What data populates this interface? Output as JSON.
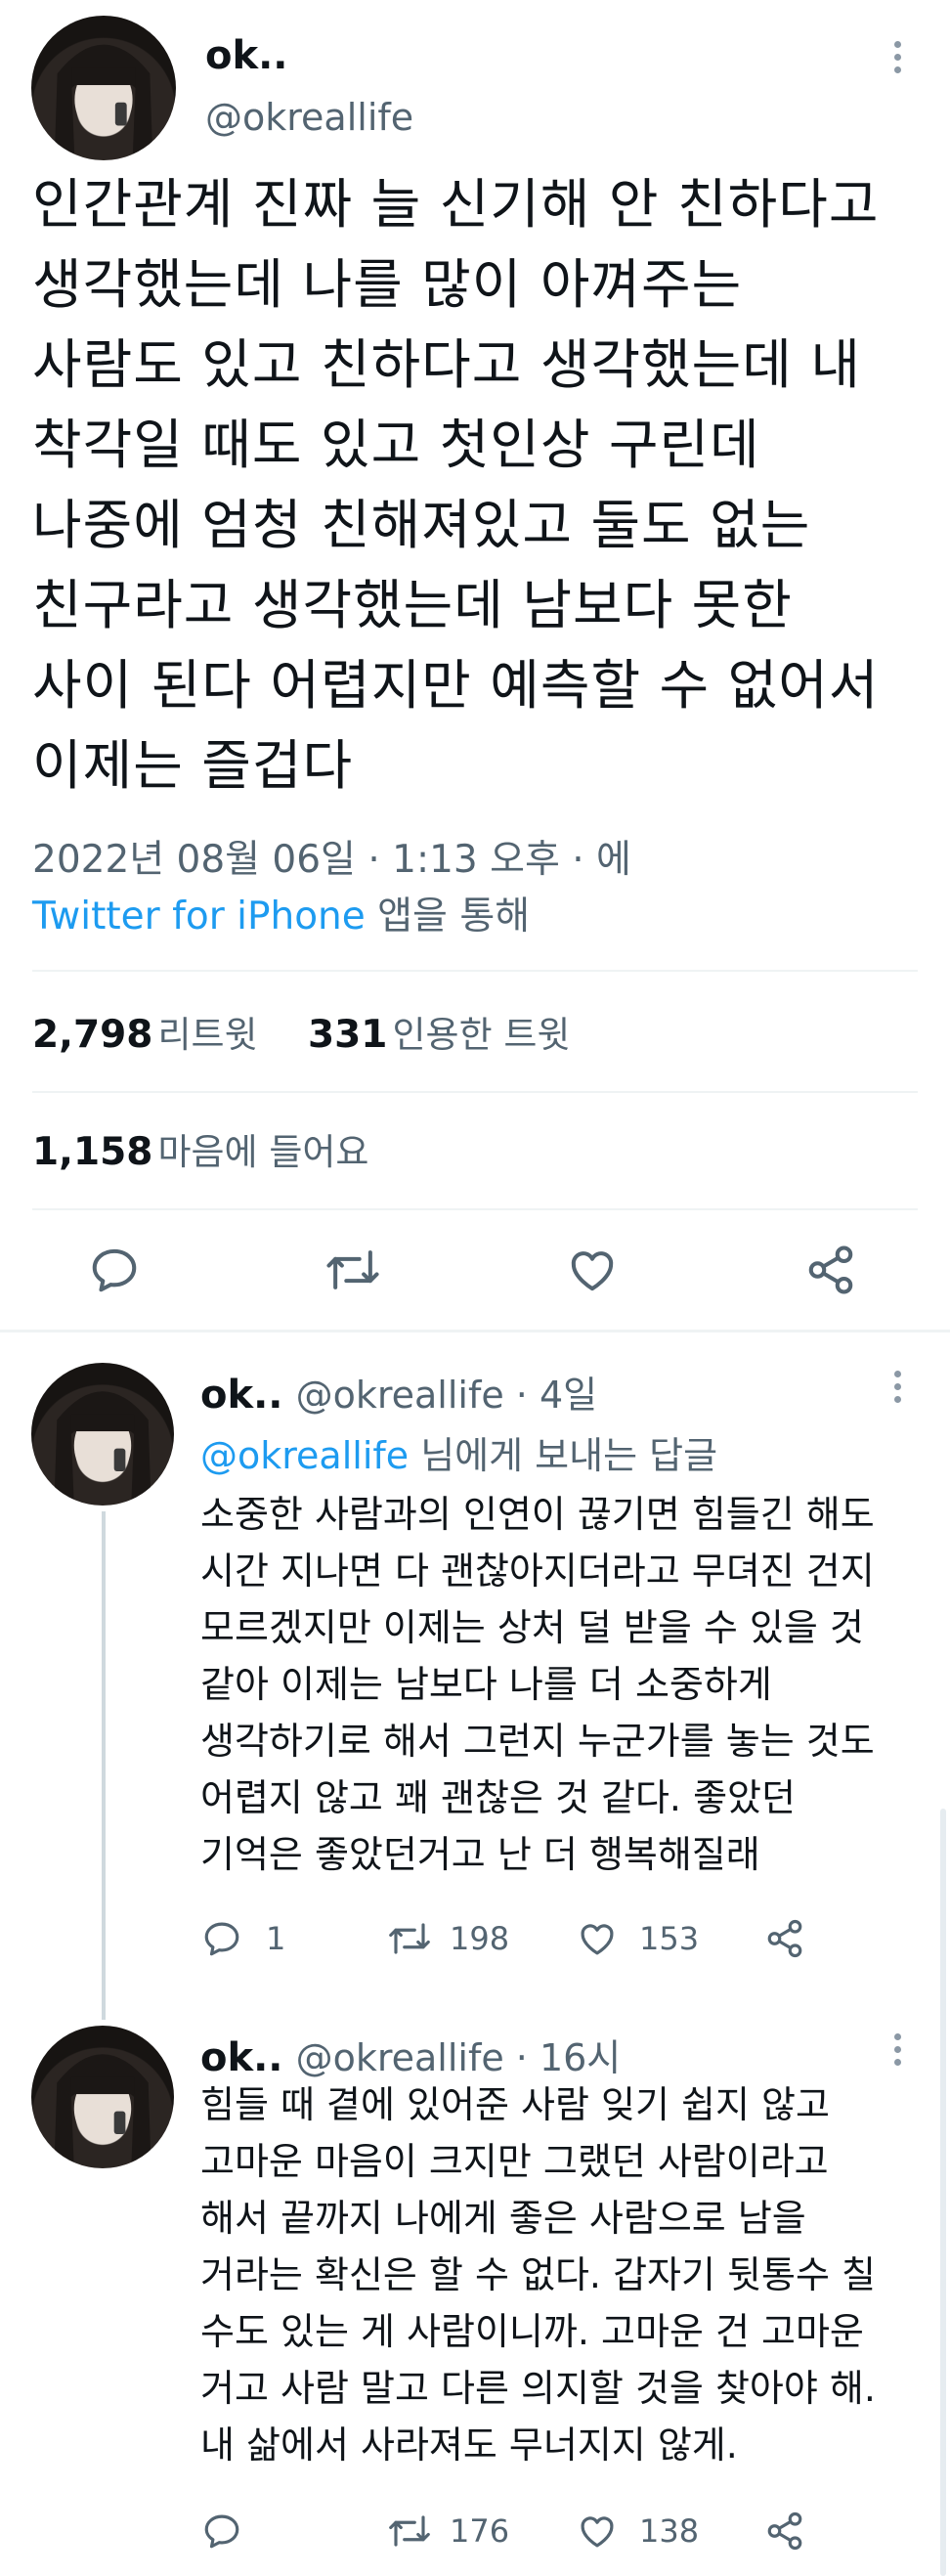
{
  "main_tweet": {
    "name": "ok..",
    "handle": "@okreallife",
    "text_lines": [
      "인간관계 진짜 늘 신기해 안 친하다고",
      "생각했는데 나를 많이 아껴주는",
      "사람도 있고 친하다고 생각했는데 내",
      "착각일 때도 있고 첫인상 구린데",
      "나중에 엄청 친해져있고 둘도 없는",
      "친구라고 생각했는데 남보다 못한",
      "사이 된다 어렵지만 예측할 수 없어서",
      "이제는 즐겁다"
    ],
    "timestamp": "2022년 08월 06일 · 1:13 오후 · 에",
    "source": "Twitter for iPhone",
    "source_suffix": " 앱을 통해",
    "retweets": "2,798",
    "retweets_label": "리트윗",
    "quotes": "331",
    "quotes_label": "인용한 트윗",
    "likes": "1,158",
    "likes_label": "마음에 들어요"
  },
  "replies": [
    {
      "name": "ok..",
      "handle_time": "@okreallife · 4일",
      "replying_to": "@okreallife",
      "replying_suffix": " 님에게 보내는 답글",
      "text_lines": [
        "소중한 사람과의 인연이 끊기면 힘들긴 해도",
        "시간 지나면 다 괜찮아지더라고 무뎌진 건지",
        "모르겠지만 이제는 상처 덜 받을 수 있을 것",
        "같아 이제는 남보다 나를 더 소중하게",
        "생각하기로 해서 그런지 누군가를 놓는 것도",
        "어렵지 않고 꽤 괜찮은 것 같다. 좋았던",
        "기억은 좋았던거고 난 더 행복해질래"
      ],
      "reply_count": "1",
      "retweet_count": "198",
      "like_count": "153"
    },
    {
      "name": "ok..",
      "handle_time": "@okreallife · 16시",
      "text_lines": [
        "힘들 때 곁에 있어준 사람 잊기 쉽지 않고",
        "고마운 마음이 크지만 그랬던 사람이라고",
        "해서 끝까지 나에게 좋은 사람으로 남을",
        "거라는 확신은 할 수 없다. 갑자기 뒷통수 칠",
        "수도 있는 게 사람이니까. 고마운 건 고마운",
        "거고 사람 말고 다른 의지할 것을 찾아야 해.",
        "내 삶에서 사라져도 무너지지 않게."
      ],
      "reply_count": "",
      "retweet_count": "176",
      "like_count": "138"
    }
  ],
  "colors": {
    "accent": "#1d9bf0",
    "muted": "#536471",
    "text": "#0f1419",
    "divider": "#eff3f4"
  },
  "icons": [
    "more-icon",
    "reply-icon",
    "retweet-icon",
    "like-icon",
    "share-icon"
  ]
}
